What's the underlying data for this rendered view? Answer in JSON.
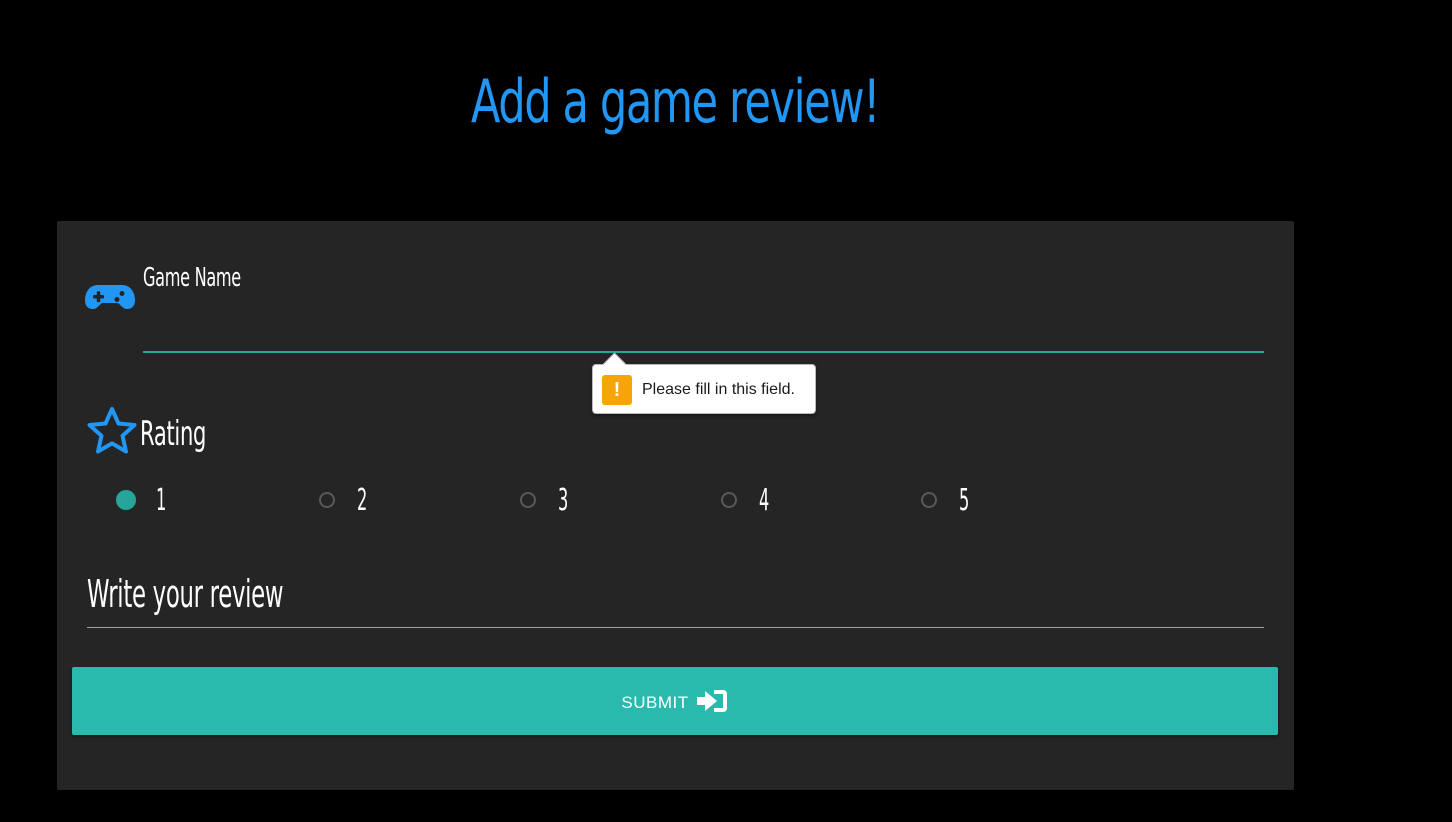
{
  "page": {
    "title": "Add a game review!"
  },
  "colors": {
    "background": "#000000",
    "card": "#252525",
    "accent_blue": "#2196f3",
    "teal": "#26a69a",
    "button": "#2ab9ad",
    "text": "#ffffff",
    "warning": "#f6a407"
  },
  "form": {
    "game_name": {
      "label": "Game Name",
      "value": "",
      "icon": "gamepad-icon"
    },
    "tooltip": {
      "message": "Please fill in this field.",
      "icon": "warning-icon",
      "icon_glyph": "!"
    },
    "rating": {
      "label": "Rating",
      "icon": "star-icon",
      "selected": "1",
      "options": [
        "1",
        "2",
        "3",
        "4",
        "5"
      ]
    },
    "review": {
      "label": "Write your review",
      "value": ""
    },
    "submit": {
      "label": "SUBMIT",
      "icon": "login-icon"
    }
  }
}
